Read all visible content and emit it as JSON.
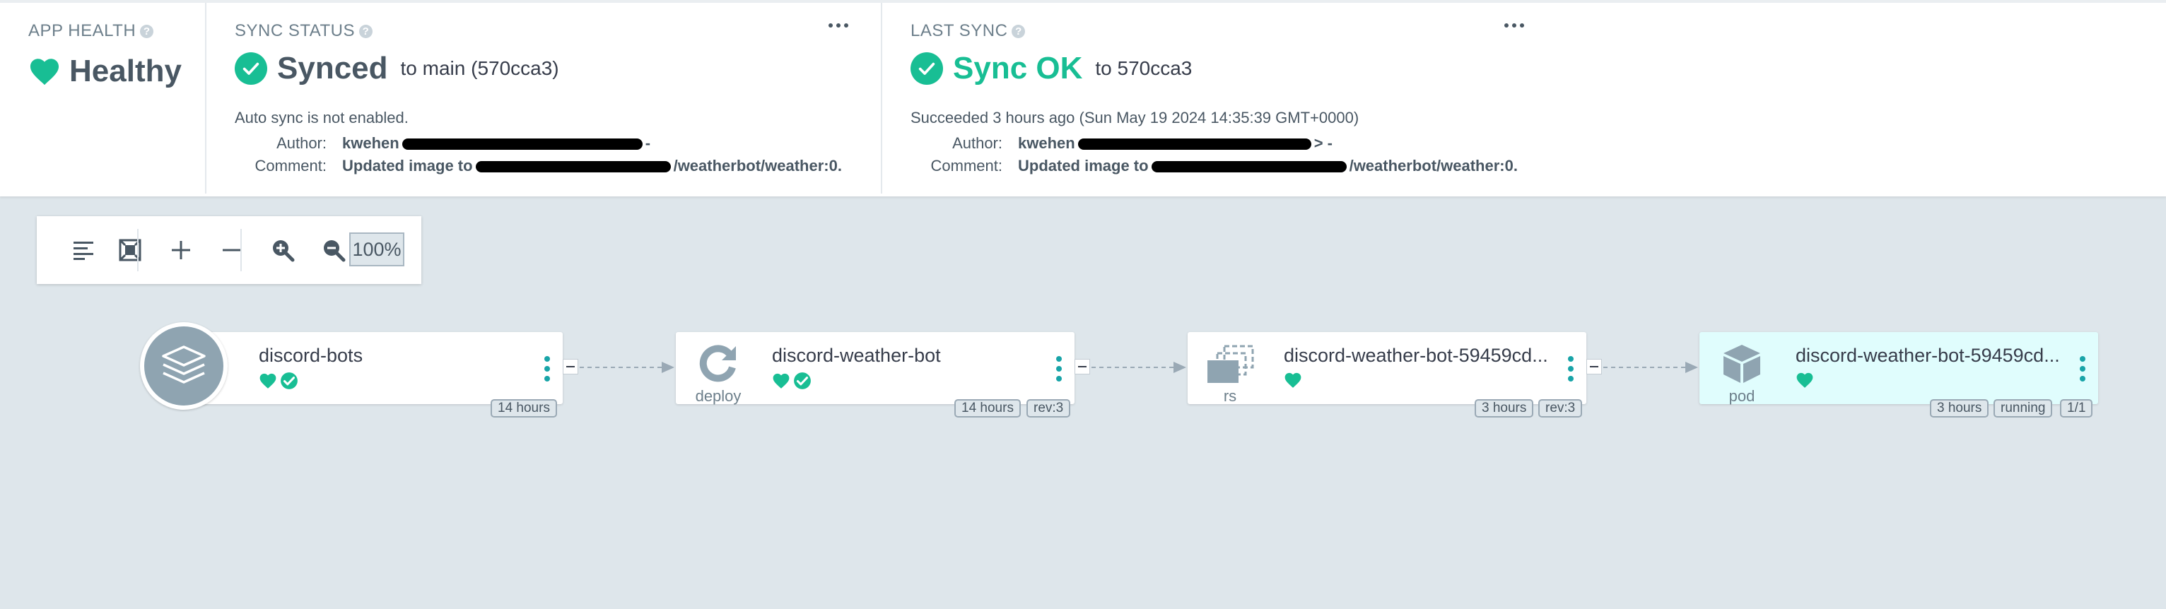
{
  "status": {
    "app_health": {
      "label": "APP HEALTH",
      "value": "Healthy"
    },
    "sync_status": {
      "label": "SYNC STATUS",
      "value": "Synced",
      "target": "to main (570cca3)",
      "note": "Auto sync is not enabled.",
      "author_key": "Author:",
      "author_name": "kwehen",
      "author_tail": "-",
      "comment_key": "Comment:",
      "comment_prefix": "Updated image to",
      "comment_suffix": "/weatherbot/weather:0."
    },
    "last_sync": {
      "label": "LAST SYNC",
      "value": "Sync OK",
      "target": "to 570cca3",
      "note": "Succeeded 3 hours ago (Sun May 19 2024 14:35:39 GMT+0000)",
      "author_key": "Author:",
      "author_name": "kwehen",
      "author_tail": "> -",
      "comment_key": "Comment:",
      "comment_prefix": "Updated image to",
      "comment_suffix": "/weatherbot/weather:0."
    }
  },
  "toolbar": {
    "zoom": "100%"
  },
  "nodes": [
    {
      "name": "discord-bots",
      "kind": "",
      "tags": [
        "14 hours"
      ]
    },
    {
      "name": "discord-weather-bot",
      "kind": "deploy",
      "tags": [
        "14 hours",
        "rev:3"
      ]
    },
    {
      "name": "discord-weather-bot-59459cd...",
      "kind": "rs",
      "tags": [
        "3 hours",
        "rev:3"
      ]
    },
    {
      "name": "discord-weather-bot-59459cd...",
      "kind": "pod",
      "tags": [
        "3 hours",
        "running",
        "1/1"
      ]
    }
  ],
  "colors": {
    "healthy": "#18be94",
    "accent": "#18a4a8",
    "background": "#dee6eb"
  }
}
